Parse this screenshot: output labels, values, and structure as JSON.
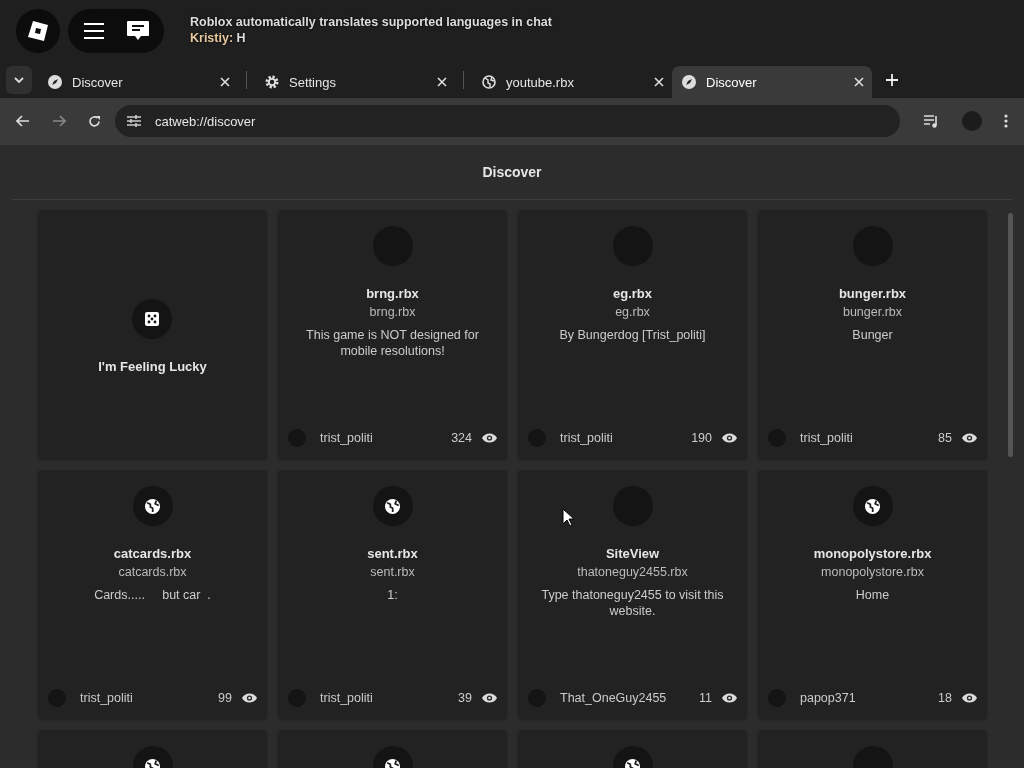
{
  "tabs": [
    {
      "label": "Discover",
      "kind": "discover",
      "selected": false
    },
    {
      "label": "Settings",
      "kind": "settings",
      "selected": false
    },
    {
      "label": "youtube.rbx",
      "kind": "site",
      "selected": false
    },
    {
      "label": "Discover",
      "kind": "discover",
      "selected": true
    }
  ],
  "address": {
    "value": "catweb://discover"
  },
  "page_title": "Discover",
  "cards": [
    {
      "kind": "lucky",
      "title": "I'm Feeling Lucky"
    },
    {
      "kind": "blank",
      "title": "brng.rbx",
      "domain": "brng.rbx",
      "description": "This game is NOT designed for mobile resolutions!",
      "author": "trist_politi",
      "views": "324"
    },
    {
      "kind": "blank",
      "title": "eg.rbx",
      "domain": "eg.rbx",
      "description": "By Bungerdog [Trist_politi]",
      "author": "trist_politi",
      "views": "190"
    },
    {
      "kind": "blank",
      "title": "bunger.rbx",
      "domain": "bunger.rbx",
      "description": "Bunger",
      "author": "trist_politi",
      "views": "85"
    },
    {
      "kind": "globe",
      "title": "catcards.rbx",
      "domain": "catcards.rbx",
      "description": "Cards.....     but car  .",
      "author": "trist_politi",
      "views": "99"
    },
    {
      "kind": "globe",
      "title": "sent.rbx",
      "domain": "sent.rbx",
      "description": "1:",
      "author": "trist_politi",
      "views": "39"
    },
    {
      "kind": "blank",
      "title": "SiteView",
      "domain": "thatoneguy2455.rbx",
      "description": "Type thatoneguy2455 to visit this website.",
      "author": "That_OneGuy2455",
      "views": "11"
    },
    {
      "kind": "globe",
      "title": "monopolystore.rbx",
      "domain": "monopolystore.rbx",
      "description": "Home",
      "author": "papop371",
      "views": "18"
    },
    {
      "kind": "globe"
    },
    {
      "kind": "globe"
    },
    {
      "kind": "globe"
    },
    {
      "kind": "blank"
    }
  ],
  "chat": [
    {
      "text": "Roblox automatically translates supported languages in chat"
    },
    {
      "author": "Kristiy:",
      "color": "#e8c9a0",
      "text": "H"
    }
  ]
}
